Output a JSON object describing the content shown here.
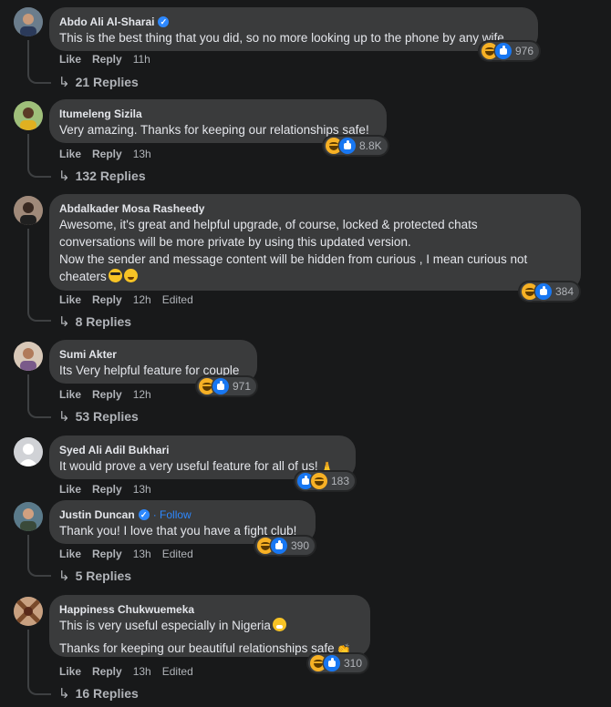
{
  "colors": {
    "background": "#18191a",
    "bubble": "#3a3b3c",
    "link": "#2d88ff",
    "muted": "#b0b3b8"
  },
  "comments": [
    {
      "author": "Abdo Ali Al-Sharai",
      "verified": true,
      "text": [
        "This is the best thing that you did, so no more looking up to the phone by any wife."
      ],
      "like": "Like",
      "reply": "Reply",
      "time": "11h",
      "reaction_icons": [
        "haha",
        "like"
      ],
      "reaction_count": "976",
      "replies": "21 Replies"
    },
    {
      "author": "Itumeleng Sizila",
      "text": [
        "Very amazing. Thanks for keeping our relationships safe!"
      ],
      "like": "Like",
      "reply": "Reply",
      "time": "13h",
      "reaction_icons": [
        "haha",
        "like"
      ],
      "reaction_count": "8.8K",
      "replies": "132 Replies"
    },
    {
      "author": "Abdalkader Mosa Rasheedy",
      "text": [
        "Awesome, it's great and helpful upgrade, of course, locked & protected chats",
        "conversations will be more private by using this updated version.",
        "Now the sender and message content will be hidden from curious , I mean curious not",
        "cheaters"
      ],
      "trailing_emoji": [
        "smiling-face-with-sunglasses",
        "grinning-face"
      ],
      "like": "Like",
      "reply": "Reply",
      "time": "12h",
      "edited": "Edited",
      "reaction_icons": [
        "haha",
        "like"
      ],
      "reaction_count": "384",
      "replies": "8 Replies"
    },
    {
      "author": "Sumi Akter",
      "text": [
        "Its Very helpful feature for couple"
      ],
      "like": "Like",
      "reply": "Reply",
      "time": "12h",
      "reaction_icons": [
        "haha",
        "like"
      ],
      "reaction_count": "971",
      "replies": "53 Replies"
    },
    {
      "author": "Syed Ali Adil Bukhari",
      "text": [
        "It would prove a very useful feature for all of us!"
      ],
      "trailing_emoji": [
        "folded-hands"
      ],
      "like": "Like",
      "reply": "Reply",
      "time": "13h",
      "reaction_icons": [
        "like",
        "haha"
      ],
      "reaction_count": "183"
    },
    {
      "author": "Justin Duncan",
      "verified": true,
      "follow": "Follow",
      "text": [
        "Thank you! I love that you have a fight club!"
      ],
      "like": "Like",
      "reply": "Reply",
      "time": "13h",
      "edited": "Edited",
      "reaction_icons": [
        "haha",
        "like"
      ],
      "reaction_count": "390",
      "replies": "5 Replies"
    },
    {
      "author": "Happiness Chukwuemeka",
      "text": [
        "This is very useful especially in Nigeria",
        "",
        "Thanks for keeping our beautiful relationships safe"
      ],
      "like": "Like",
      "reply": "Reply",
      "time": "13h",
      "edited": "Edited",
      "reaction_icons": [
        "haha",
        "like"
      ],
      "reaction_count": "310",
      "replies": "16 Replies"
    }
  ]
}
